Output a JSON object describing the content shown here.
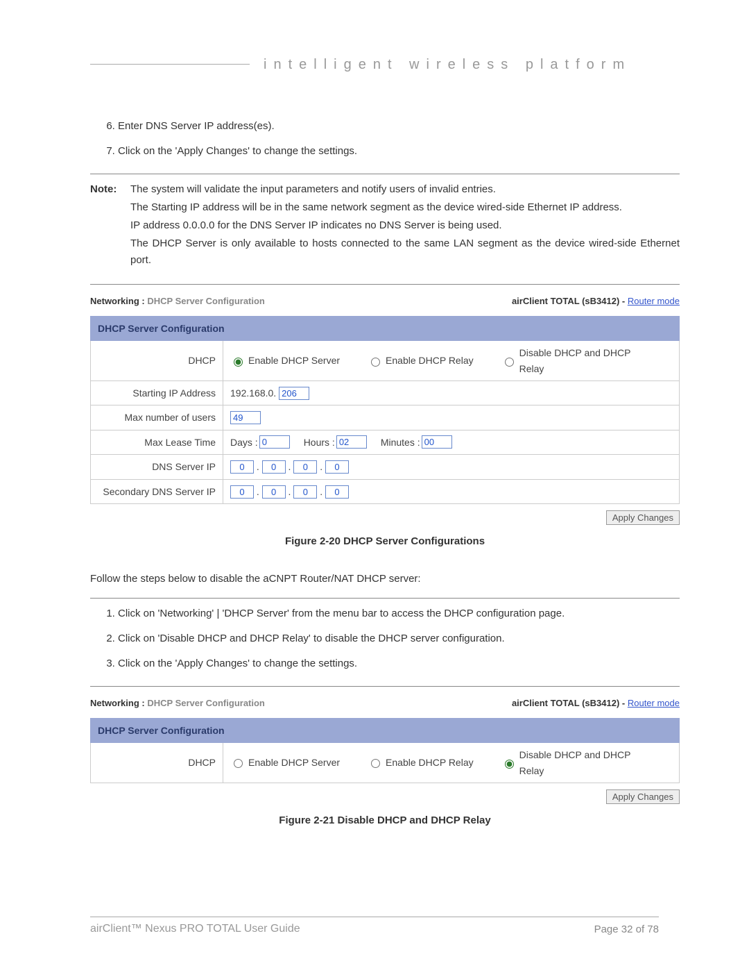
{
  "header": {
    "tagline": "intelligent  wireless  platform"
  },
  "steps_cont": [
    {
      "num": 6,
      "text": "Enter DNS Server IP address(es)."
    },
    {
      "num": 7,
      "text": "Click on the 'Apply Changes' to change the settings."
    }
  ],
  "note": {
    "label": "Note:",
    "lines": [
      "The system will validate the input parameters and notify users of invalid entries.",
      "The Starting IP address will be in the same network segment as the device wired-side Ethernet IP address.",
      "IP address 0.0.0.0 for the DNS Server IP indicates no DNS Server is being used.",
      "The DHCP Server is only available to hosts connected to the same LAN segment as the device wired-side Ethernet port."
    ]
  },
  "figure1": {
    "breadcrumb_prefix": "Networking :",
    "breadcrumb_sub": "DHCP Server Configuration",
    "device": "airClient TOTAL (sB3412)",
    "sep": " - ",
    "mode": "Router mode",
    "title": "DHCP Server Configuration",
    "rows": {
      "dhcp_label": "DHCP",
      "dhcp_options": [
        {
          "label": "Enable DHCP Server",
          "checked": true
        },
        {
          "label": "Enable DHCP Relay",
          "checked": false
        },
        {
          "label": "Disable DHCP and DHCP Relay",
          "checked": false
        }
      ],
      "starting_ip_label": "Starting IP Address",
      "starting_ip_prefix": "192.168.0.",
      "starting_ip_last": "206",
      "max_users_label": "Max number of users",
      "max_users": "49",
      "max_lease_label": "Max Lease Time",
      "lease_days_label": "Days :",
      "lease_days": "0",
      "lease_hours_label": "Hours :",
      "lease_hours": "02",
      "lease_minutes_label": "Minutes :",
      "lease_minutes": "00",
      "dns_label": "DNS Server IP",
      "dns_ip": [
        "0",
        "0",
        "0",
        "0"
      ],
      "dns2_label": "Secondary DNS Server IP",
      "dns2_ip": [
        "0",
        "0",
        "0",
        "0"
      ]
    },
    "apply": "Apply Changes",
    "caption": "Figure 2-20 DHCP Server Configurations"
  },
  "disable_intro": "Follow the steps below to disable the aCNPT Router/NAT DHCP server:",
  "disable_steps": [
    {
      "num": 1,
      "text": "Click on 'Networking' | 'DHCP Server' from the menu bar to access the DHCP configuration page."
    },
    {
      "num": 2,
      "text": "Click on 'Disable DHCP and DHCP Relay' to disable the DHCP server configuration."
    },
    {
      "num": 3,
      "text": "Click on the 'Apply Changes' to change the settings."
    }
  ],
  "figure2": {
    "breadcrumb_prefix": "Networking :",
    "breadcrumb_sub": "DHCP Server Configuration",
    "device": "airClient TOTAL (sB3412)",
    "sep": " - ",
    "mode": "Router mode",
    "title": "DHCP Server Configuration",
    "rows": {
      "dhcp_label": "DHCP",
      "dhcp_options": [
        {
          "label": "Enable DHCP Server",
          "checked": false
        },
        {
          "label": "Enable DHCP Relay",
          "checked": false
        },
        {
          "label": "Disable DHCP and DHCP Relay",
          "checked": true
        }
      ]
    },
    "apply": "Apply Changes",
    "caption": "Figure 2-21 Disable DHCP and DHCP Relay"
  },
  "footer": {
    "left": "airClient™ Nexus PRO TOTAL User Guide",
    "right": "Page 32 of 78"
  }
}
